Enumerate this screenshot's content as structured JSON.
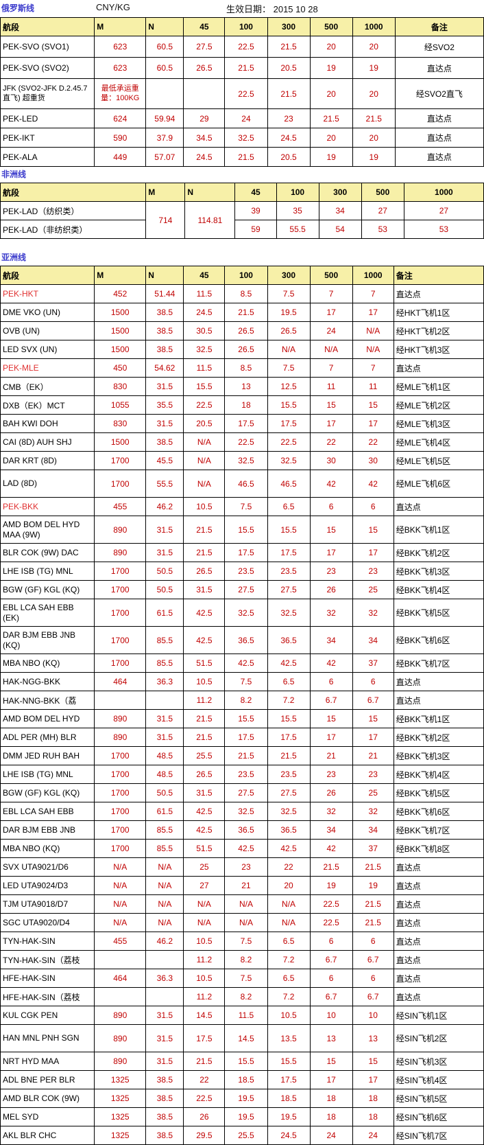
{
  "meta": {
    "line_label": "俄罗斯线",
    "unit": "CNY/KG",
    "effective_date": "生效日期： 2015 10 28"
  },
  "colors": {
    "header_bg": "#f7f0a8",
    "value_red": "#c00000",
    "section_blue": "#3a3acc",
    "highlight_red": "#e03030"
  },
  "sections": {
    "russia": {
      "label": "俄罗斯线",
      "headers": [
        "航段",
        "M",
        "N",
        "45",
        "100",
        "300",
        "500",
        "1000",
        "备注"
      ],
      "rows": [
        {
          "seg": "PEK-SVO (SVO1)",
          "m": "623",
          "n": "60.5",
          "v45": "27.5",
          "v100": "22.5",
          "v300": "21.5",
          "v500": "20",
          "v1000": "20",
          "note": "经SVO2"
        },
        {
          "seg": "PEK-SVO (SVO2)",
          "m": "623",
          "n": "60.5",
          "v45": "26.5",
          "v100": "21.5",
          "v300": "20.5",
          "v500": "19",
          "v1000": "19",
          "note": "直达点"
        },
        {
          "seg": "JFK (SVO2-JFK D.2.45.7直飞) 超重货",
          "m": "最低承运重量：100KG",
          "n": "",
          "v45": "",
          "v100": "22.5",
          "v300": "21.5",
          "v500": "20",
          "v1000": "20",
          "note": "经SVO2直飞"
        },
        {
          "seg": "PEK-LED",
          "m": "624",
          "n": "59.94",
          "v45": "29",
          "v100": "24",
          "v300": "23",
          "v500": "21.5",
          "v1000": "21.5",
          "note": "直达点"
        },
        {
          "seg": "PEK-IKT",
          "m": "590",
          "n": "37.9",
          "v45": "34.5",
          "v100": "32.5",
          "v300": "24.5",
          "v500": "20",
          "v1000": "20",
          "note": "直达点"
        },
        {
          "seg": "PEK-ALA",
          "m": "449",
          "n": "57.07",
          "v45": "24.5",
          "v100": "21.5",
          "v300": "20.5",
          "v500": "19",
          "v1000": "19",
          "note": "直达点"
        }
      ]
    },
    "africa": {
      "label": "非洲线",
      "headers": [
        "航段",
        "M",
        "N",
        "45",
        "100",
        "300",
        "500",
        "1000"
      ],
      "merged_m": "714",
      "merged_n": "114.81",
      "rows": [
        {
          "seg": "PEK-LAD（纺织类）",
          "v45": "39",
          "v100": "35",
          "v300": "34",
          "v500": "27",
          "v1000": "27"
        },
        {
          "seg": "PEK-LAD（非纺织类）",
          "v45": "59",
          "v100": "55.5",
          "v300": "54",
          "v500": "53",
          "v1000": "53"
        }
      ]
    },
    "asia": {
      "label": "亚洲线",
      "headers": [
        "航段",
        "M",
        "N",
        "45",
        "100",
        "300",
        "500",
        "1000",
        "备注"
      ],
      "rows": [
        {
          "seg": "PEK-HKT",
          "m": "452",
          "n": "51.44",
          "v45": "11.5",
          "v100": "8.5",
          "v300": "7.5",
          "v500": "7",
          "v1000": "7",
          "note": "直达点",
          "hl": true
        },
        {
          "seg": "DME VKO (UN)",
          "m": "1500",
          "n": "38.5",
          "v45": "24.5",
          "v100": "21.5",
          "v300": "19.5",
          "v500": "17",
          "v1000": "17",
          "note": "经HKT飞机1区"
        },
        {
          "seg": "OVB (UN)",
          "m": "1500",
          "n": "38.5",
          "v45": "30.5",
          "v100": "26.5",
          "v300": "26.5",
          "v500": "24",
          "v1000": "N/A",
          "note": "经HKT飞机2区"
        },
        {
          "seg": "LED SVX (UN)",
          "m": "1500",
          "n": "38.5",
          "v45": "32.5",
          "v100": "26.5",
          "v300": "N/A",
          "v500": "N/A",
          "v1000": "N/A",
          "note": "经HKT飞机3区"
        },
        {
          "seg": "PEK-MLE",
          "m": "450",
          "n": "54.62",
          "v45": "11.5",
          "v100": "8.5",
          "v300": "7.5",
          "v500": "7",
          "v1000": "7",
          "note": "直达点",
          "hl": true
        },
        {
          "seg": "CMB（EK）",
          "m": "830",
          "n": "31.5",
          "v45": "15.5",
          "v100": "13",
          "v300": "12.5",
          "v500": "11",
          "v1000": "11",
          "note": "经MLE飞机1区"
        },
        {
          "seg": "DXB（EK）MCT",
          "m": "1055",
          "n": "35.5",
          "v45": "22.5",
          "v100": "18",
          "v300": "15.5",
          "v500": "15",
          "v1000": "15",
          "note": "经MLE飞机2区"
        },
        {
          "seg": "BAH KWI DOH",
          "m": "830",
          "n": "31.5",
          "v45": "20.5",
          "v100": "17.5",
          "v300": "17.5",
          "v500": "17",
          "v1000": "17",
          "note": "经MLE飞机3区"
        },
        {
          "seg": "CAI (8D) AUH SHJ",
          "m": "1500",
          "n": "38.5",
          "v45": "N/A",
          "v100": "22.5",
          "v300": "22.5",
          "v500": "22",
          "v1000": "22",
          "note": "经MLE飞机4区"
        },
        {
          "seg": "DAR KRT (8D)",
          "m": "1700",
          "n": "45.5",
          "v45": "N/A",
          "v100": "32.5",
          "v300": "32.5",
          "v500": "30",
          "v1000": "30",
          "note": "经MLE飞机5区"
        },
        {
          "seg": "LAD (8D)",
          "m": "1700",
          "n": "55.5",
          "v45": "N/A",
          "v100": "46.5",
          "v300": "46.5",
          "v500": "42",
          "v1000": "42",
          "note": "经MLE飞机6区",
          "tall": true
        },
        {
          "seg": "PEK-BKK",
          "m": "455",
          "n": "46.2",
          "v45": "10.5",
          "v100": "7.5",
          "v300": "6.5",
          "v500": "6",
          "v1000": "6",
          "note": "直达点",
          "hl": true
        },
        {
          "seg": "AMD BOM DEL HYD MAA (9W)",
          "m": "890",
          "n": "31.5",
          "v45": "21.5",
          "v100": "15.5",
          "v300": "15.5",
          "v500": "15",
          "v1000": "15",
          "note": "经BKK飞机1区",
          "tall": true
        },
        {
          "seg": "BLR COK (9W) DAC",
          "m": "890",
          "n": "31.5",
          "v45": "21.5",
          "v100": "17.5",
          "v300": "17.5",
          "v500": "17",
          "v1000": "17",
          "note": "经BKK飞机2区"
        },
        {
          "seg": "LHE ISB (TG) MNL",
          "m": "1700",
          "n": "50.5",
          "v45": "26.5",
          "v100": "23.5",
          "v300": "23.5",
          "v500": "23",
          "v1000": "23",
          "note": "经BKK飞机3区"
        },
        {
          "seg": "BGW (GF) KGL (KQ)",
          "m": "1700",
          "n": "50.5",
          "v45": "31.5",
          "v100": "27.5",
          "v300": "27.5",
          "v500": "26",
          "v1000": "25",
          "note": "经BKK飞机4区"
        },
        {
          "seg": "EBL LCA SAH EBB (EK)",
          "m": "1700",
          "n": "61.5",
          "v45": "42.5",
          "v100": "32.5",
          "v300": "32.5",
          "v500": "32",
          "v1000": "32",
          "note": "经BKK飞机5区",
          "tall": true
        },
        {
          "seg": "DAR BJM EBB JNB (KQ)",
          "m": "1700",
          "n": "85.5",
          "v45": "42.5",
          "v100": "36.5",
          "v300": "36.5",
          "v500": "34",
          "v1000": "34",
          "note": "经BKK飞机6区",
          "tall": true
        },
        {
          "seg": "MBA NBO (KQ)",
          "m": "1700",
          "n": "85.5",
          "v45": "51.5",
          "v100": "42.5",
          "v300": "42.5",
          "v500": "42",
          "v1000": "37",
          "note": "经BKK飞机7区"
        },
        {
          "seg": "HAK-NGG-BKK",
          "m": "464",
          "n": "36.3",
          "v45": "10.5",
          "v100": "7.5",
          "v300": "6.5",
          "v500": "6",
          "v1000": "6",
          "note": "直达点"
        },
        {
          "seg": "HAK-NNG-BKK（荔",
          "m": "",
          "n": "",
          "v45": "11.2",
          "v100": "8.2",
          "v300": "7.2",
          "v500": "6.7",
          "v1000": "6.7",
          "note": "直达点"
        },
        {
          "seg": "AMD BOM DEL HYD",
          "m": "890",
          "n": "31.5",
          "v45": "21.5",
          "v100": "15.5",
          "v300": "15.5",
          "v500": "15",
          "v1000": "15",
          "note": "经BKK飞机1区"
        },
        {
          "seg": "ADL PER (MH) BLR",
          "m": "890",
          "n": "31.5",
          "v45": "21.5",
          "v100": "17.5",
          "v300": "17.5",
          "v500": "17",
          "v1000": "17",
          "note": "经BKK飞机2区"
        },
        {
          "seg": "DMM JED RUH BAH",
          "m": "1700",
          "n": "48.5",
          "v45": "25.5",
          "v100": "21.5",
          "v300": "21.5",
          "v500": "21",
          "v1000": "21",
          "note": "经BKK飞机3区"
        },
        {
          "seg": "LHE ISB (TG) MNL",
          "m": "1700",
          "n": "48.5",
          "v45": "26.5",
          "v100": "23.5",
          "v300": "23.5",
          "v500": "23",
          "v1000": "23",
          "note": "经BKK飞机4区"
        },
        {
          "seg": "BGW (GF) KGL (KQ)",
          "m": "1700",
          "n": "50.5",
          "v45": "31.5",
          "v100": "27.5",
          "v300": "27.5",
          "v500": "26",
          "v1000": "25",
          "note": "经BKK飞机5区"
        },
        {
          "seg": "EBL LCA SAH EBB",
          "m": "1700",
          "n": "61.5",
          "v45": "42.5",
          "v100": "32.5",
          "v300": "32.5",
          "v500": "32",
          "v1000": "32",
          "note": "经BKK飞机6区"
        },
        {
          "seg": "DAR BJM EBB JNB",
          "m": "1700",
          "n": "85.5",
          "v45": "42.5",
          "v100": "36.5",
          "v300": "36.5",
          "v500": "34",
          "v1000": "34",
          "note": "经BKK飞机7区"
        },
        {
          "seg": "MBA NBO (KQ)",
          "m": "1700",
          "n": "85.5",
          "v45": "51.5",
          "v100": "42.5",
          "v300": "42.5",
          "v500": "42",
          "v1000": "37",
          "note": "经BKK飞机8区"
        },
        {
          "seg": "SVX  UTA9021/D6",
          "m": "N/A",
          "n": "N/A",
          "v45": "25",
          "v100": "23",
          "v300": "22",
          "v500": "21.5",
          "v1000": "21.5",
          "note": "直达点"
        },
        {
          "seg": "LED  UTA9024/D3",
          "m": "N/A",
          "n": "N/A",
          "v45": "27",
          "v100": "21",
          "v300": "20",
          "v500": "19",
          "v1000": "19",
          "note": "直达点"
        },
        {
          "seg": "TJM  UTA9018/D7",
          "m": "N/A",
          "n": "N/A",
          "v45": "N/A",
          "v100": "N/A",
          "v300": "N/A",
          "v500": "22.5",
          "v1000": "21.5",
          "note": "直达点"
        },
        {
          "seg": "SGC  UTA9020/D4",
          "m": "N/A",
          "n": "N/A",
          "v45": "N/A",
          "v100": "N/A",
          "v300": "N/A",
          "v500": "22.5",
          "v1000": "21.5",
          "note": "直达点"
        },
        {
          "seg": "TYN-HAK-SIN",
          "m": "455",
          "n": "46.2",
          "v45": "10.5",
          "v100": "7.5",
          "v300": "6.5",
          "v500": "6",
          "v1000": "6",
          "note": "直达点"
        },
        {
          "seg": "TYN-HAK-SIN（荔枝",
          "m": "",
          "n": "",
          "v45": "11.2",
          "v100": "8.2",
          "v300": "7.2",
          "v500": "6.7",
          "v1000": "6.7",
          "note": "直达点"
        },
        {
          "seg": "HFE-HAK-SIN",
          "m": "464",
          "n": "36.3",
          "v45": "10.5",
          "v100": "7.5",
          "v300": "6.5",
          "v500": "6",
          "v1000": "6",
          "note": "直达点"
        },
        {
          "seg": "HFE-HAK-SIN（荔枝",
          "m": "",
          "n": "",
          "v45": "11.2",
          "v100": "8.2",
          "v300": "7.2",
          "v500": "6.7",
          "v1000": "6.7",
          "note": "直达点"
        },
        {
          "seg": "KUL CGK PEN",
          "m": "890",
          "n": "31.5",
          "v45": "14.5",
          "v100": "11.5",
          "v300": "10.5",
          "v500": "10",
          "v1000": "10",
          "note": "经SIN飞机1区"
        },
        {
          "seg": "HAN MNL PNH SGN",
          "m": "890",
          "n": "31.5",
          "v45": "17.5",
          "v100": "14.5",
          "v300": "13.5",
          "v500": "13",
          "v1000": "13",
          "note": "经SIN飞机2区",
          "tall": true
        },
        {
          "seg": "NRT HYD MAA",
          "m": "890",
          "n": "31.5",
          "v45": "21.5",
          "v100": "15.5",
          "v300": "15.5",
          "v500": "15",
          "v1000": "15",
          "note": "经SIN飞机3区"
        },
        {
          "seg": "ADL BNE PER BLR",
          "m": "1325",
          "n": "38.5",
          "v45": "22",
          "v100": "18.5",
          "v300": "17.5",
          "v500": "17",
          "v1000": "17",
          "note": "经SIN飞机4区"
        },
        {
          "seg": "AMD BLR COK (9W)",
          "m": "1325",
          "n": "38.5",
          "v45": "22.5",
          "v100": "19.5",
          "v300": "18.5",
          "v500": "18",
          "v1000": "18",
          "note": "经SIN飞机5区"
        },
        {
          "seg": "MEL SYD",
          "m": "1325",
          "n": "38.5",
          "v45": "26",
          "v100": "19.5",
          "v300": "19.5",
          "v500": "18",
          "v1000": "18",
          "note": "经SIN飞机6区"
        },
        {
          "seg": "AKL BLR CHC",
          "m": "1325",
          "n": "38.5",
          "v45": "29.5",
          "v100": "25.5",
          "v300": "24.5",
          "v500": "24",
          "v1000": "24",
          "note": "经SIN飞机7区"
        }
      ]
    }
  }
}
